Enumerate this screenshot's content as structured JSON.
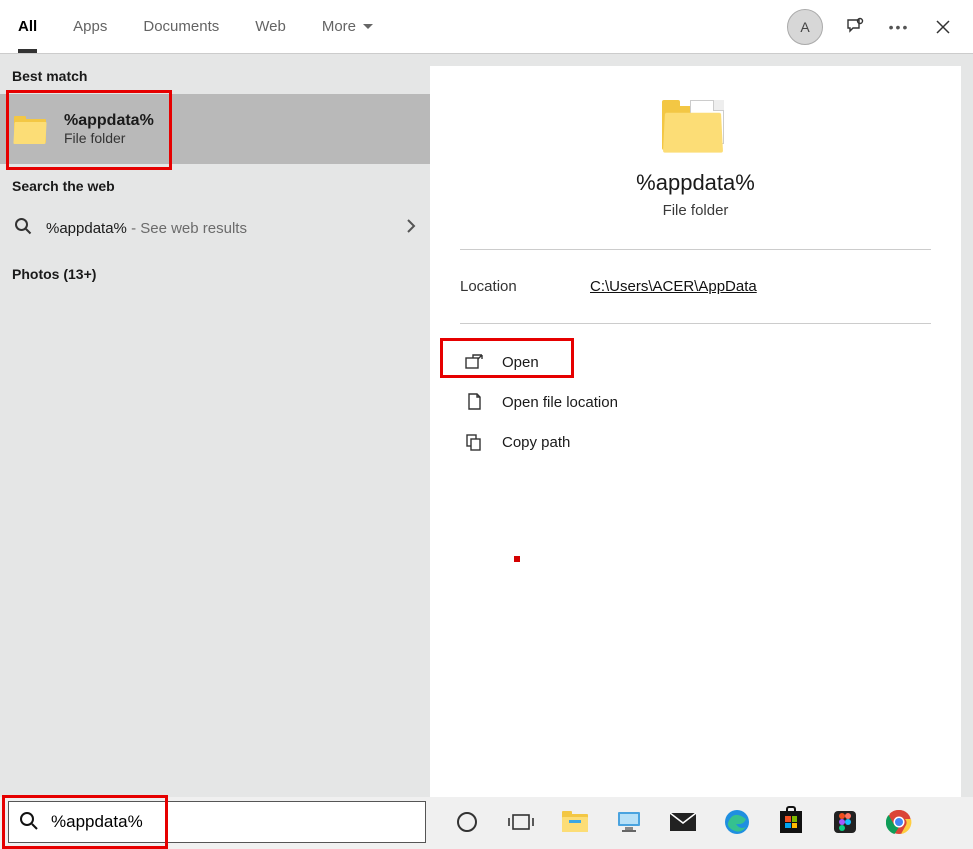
{
  "header": {
    "tabs": {
      "all": "All",
      "apps": "Apps",
      "documents": "Documents",
      "web": "Web",
      "more": "More"
    },
    "avatar_initial": "A"
  },
  "left": {
    "best_match_header": "Best match",
    "best_match": {
      "title": "%appdata%",
      "subtitle": "File folder"
    },
    "web_header": "Search the web",
    "web_item": {
      "query": "%appdata%",
      "suffix": "- See web results"
    },
    "photos_header": "Photos (13+)"
  },
  "detail": {
    "title": "%appdata%",
    "subtitle": "File folder",
    "location_label": "Location",
    "location_value": "C:\\Users\\ACER\\AppData",
    "actions": {
      "open": "Open",
      "open_location": "Open file location",
      "copy_path": "Copy path"
    }
  },
  "taskbar": {
    "search_value": "%appdata%"
  }
}
